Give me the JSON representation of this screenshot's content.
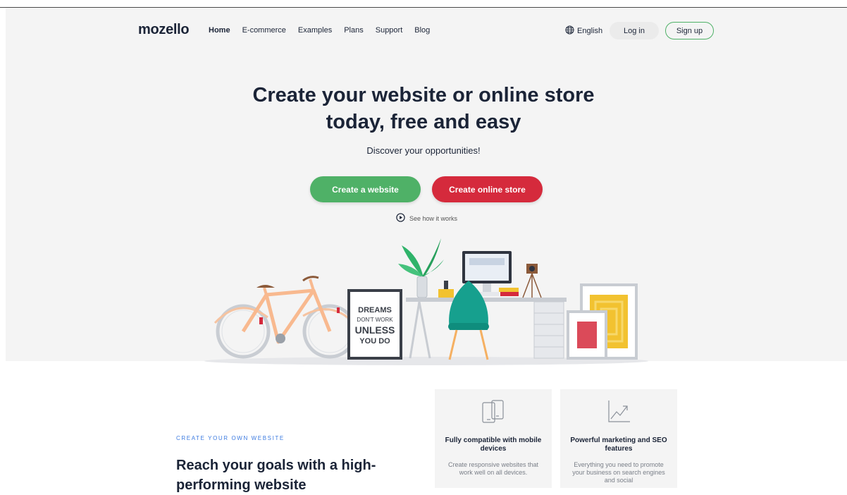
{
  "header": {
    "logo": "mozello",
    "nav": [
      "Home",
      "E-commerce",
      "Examples",
      "Plans",
      "Support",
      "Blog"
    ],
    "language": "English",
    "login": "Log in",
    "signup": "Sign up"
  },
  "hero": {
    "title_line1": "Create your website or online store",
    "title_line2": "today, free and easy",
    "subtitle": "Discover your opportunities!",
    "cta_website": "Create a website",
    "cta_store": "Create online store",
    "how_it_works": "See how it works"
  },
  "illustration": {
    "frame_line1": "DREAMS",
    "frame_line2": "DON'T WORK",
    "frame_line3": "UNLESS",
    "frame_line4": "YOU DO"
  },
  "features": {
    "eyebrow": "CREATE YOUR OWN WEBSITE",
    "heading": "Reach your goals with a high-performing website",
    "cards": [
      {
        "icon": "mobile-devices-icon",
        "title": "Fully compatible with mobile devices",
        "desc": "Create responsive websites that work well on all devices."
      },
      {
        "icon": "chart-growth-icon",
        "title": "Powerful marketing and SEO features",
        "desc": "Everything you need to promote your business on search engines and social"
      }
    ]
  },
  "colors": {
    "green": "#4fb167",
    "red": "#d52a3c",
    "navy": "#1b2437",
    "blue": "#3d7be0"
  }
}
